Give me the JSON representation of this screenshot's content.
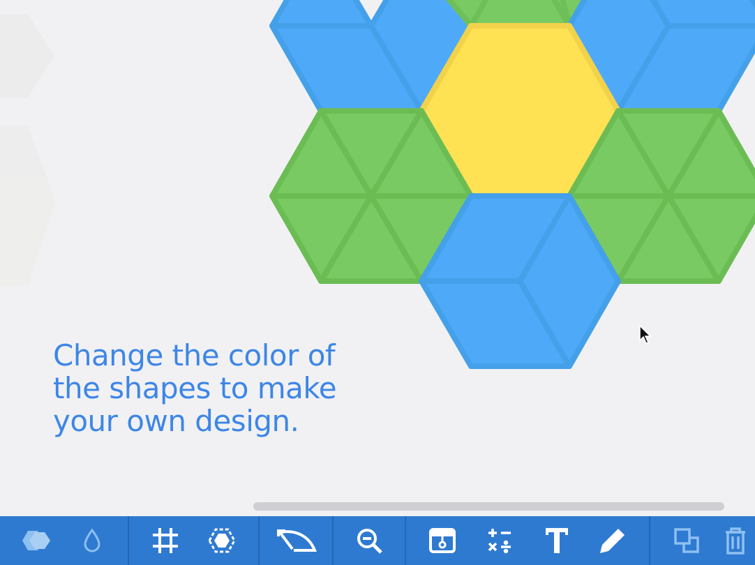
{
  "instruction": {
    "line1": "Change the color of",
    "line2": "the shapes to make",
    "line3": "your own design."
  },
  "colors": {
    "background": "#f1f1f3",
    "hexagon_yellow": "#ffe154",
    "rhombus_blue": "#4eaaf8",
    "triangle_green": "#7aca63",
    "toolbar": "#2f7ad1",
    "instruction_text": "#3d86e6"
  },
  "toolbar": {
    "buttons": [
      {
        "icon": "shapes-icon",
        "active": false
      },
      {
        "icon": "color-drop-icon",
        "active": false
      },
      {
        "icon": "grid-icon",
        "active": true
      },
      {
        "icon": "hexagon-outline-icon",
        "active": true
      },
      {
        "icon": "rotate-icon",
        "active": true
      },
      {
        "icon": "zoom-out-icon",
        "active": true
      },
      {
        "icon": "card-icon",
        "active": true
      },
      {
        "icon": "math-operations-icon",
        "active": true
      },
      {
        "icon": "text-icon",
        "active": true
      },
      {
        "icon": "pencil-icon",
        "active": true
      },
      {
        "icon": "duplicate-icon",
        "active": false
      },
      {
        "icon": "trash-icon",
        "active": false
      }
    ]
  }
}
